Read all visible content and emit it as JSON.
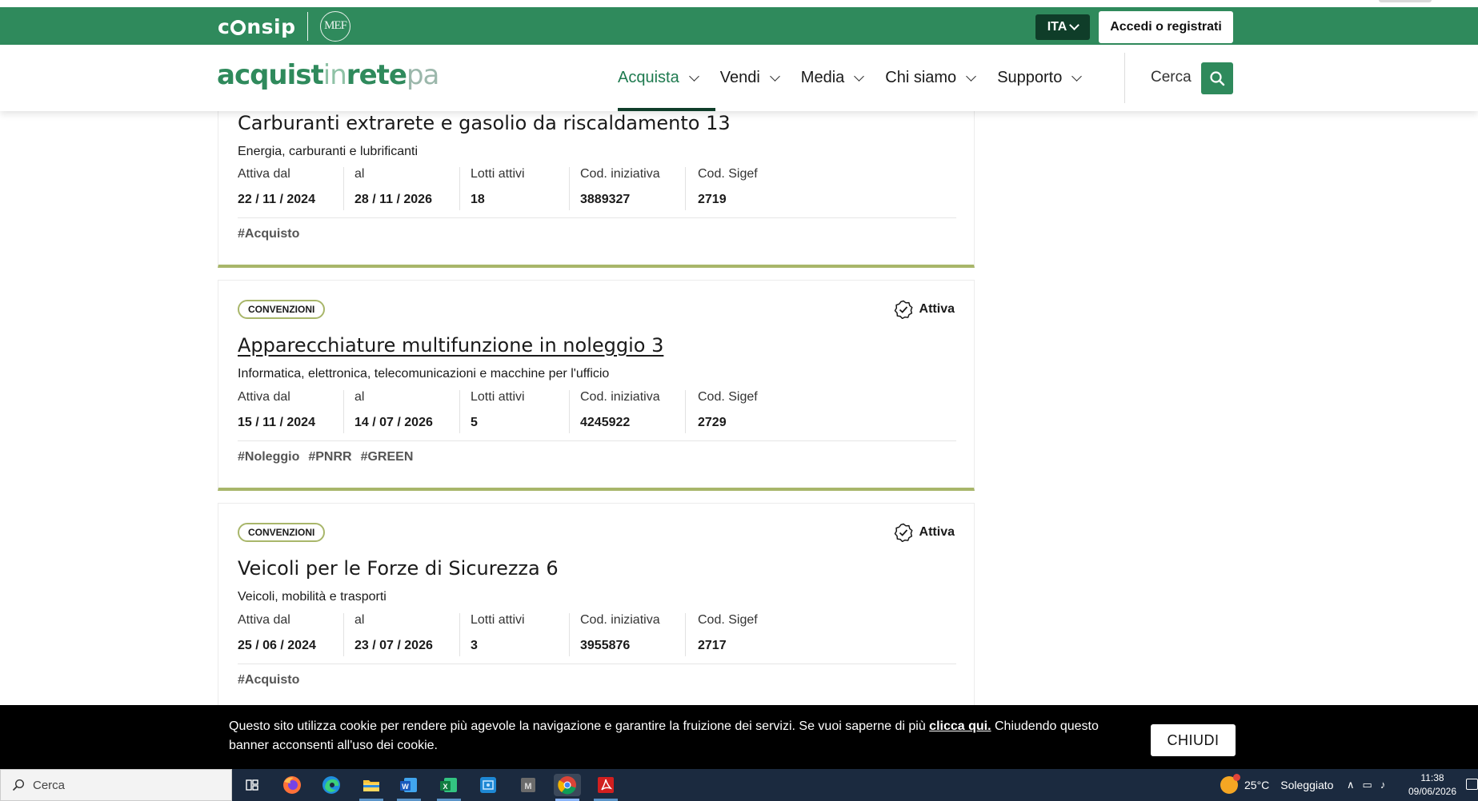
{
  "consip_bar": {
    "logo": "cnsip",
    "mef_logo": "MEF",
    "lang_label": "ITA",
    "login_label": "Accedi o registrati"
  },
  "header": {
    "brand": {
      "part1": "acquist",
      "part2": "in",
      "part3": "rete",
      "part4": "pa"
    },
    "nav": [
      {
        "label": "Acquista",
        "active": true
      },
      {
        "label": "Vendi"
      },
      {
        "label": "Media"
      },
      {
        "label": "Chi siamo"
      },
      {
        "label": "Supporto"
      }
    ],
    "search_label": "Cerca"
  },
  "cards": [
    {
      "badge": "",
      "status": "",
      "title": "Carburanti extrarete e gasolio da riscaldamento 13",
      "category": "Energia, carburanti e lubrificanti",
      "meta_labels": [
        "Attiva dal",
        "al",
        "Lotti attivi",
        "Cod. iniziativa",
        "Cod. Sigef"
      ],
      "meta_values": [
        "22 / 11 / 2024",
        "28 / 11 / 2026",
        "18",
        "3889327",
        "2719"
      ],
      "tags": [
        "#Acquisto"
      ]
    },
    {
      "badge": "CONVENZIONI",
      "status": "Attiva",
      "title": "Apparecchiature multifunzione in noleggio 3",
      "category": "Informatica, elettronica, telecomunicazioni e macchine per l'ufficio",
      "meta_labels": [
        "Attiva dal",
        "al",
        "Lotti attivi",
        "Cod. iniziativa",
        "Cod. Sigef"
      ],
      "meta_values": [
        "15 / 11 / 2024",
        "14 / 07 / 2026",
        "5",
        "4245922",
        "2729"
      ],
      "tags": [
        "#Noleggio",
        "#PNRR",
        "#GREEN"
      ]
    },
    {
      "badge": "CONVENZIONI",
      "status": "Attiva",
      "title": "Veicoli per le Forze di Sicurezza 6",
      "category": "Veicoli, mobilità e trasporti",
      "meta_labels": [
        "Attiva dal",
        "al",
        "Lotti attivi",
        "Cod. iniziativa",
        "Cod. Sigef"
      ],
      "meta_values": [
        "25 / 06 / 2024",
        "23 / 07 / 2026",
        "3",
        "3955876",
        "2717"
      ],
      "tags": [
        "#Acquisto"
      ]
    }
  ],
  "cookie": {
    "text_before": "Questo sito utilizza cookie per rendere più agevole la navigazione e garantire la fruizione dei servizi. Se vuoi saperne di più ",
    "link": "clicca qui.",
    "text_after": " Chiudendo questo banner acconsenti all'uso dei cookie.",
    "button": "CHIUDI"
  },
  "taskbar": {
    "search_placeholder": "Cerca",
    "apps": [
      "task-view",
      "firefox",
      "edge",
      "file-explorer",
      "word",
      "excel",
      "app-blue",
      "app-grey",
      "chrome",
      "acrobat"
    ],
    "weather_temp": "25°C",
    "weather_text": "Soleggiato",
    "time": "11:38",
    "date": "09/06/2026"
  }
}
